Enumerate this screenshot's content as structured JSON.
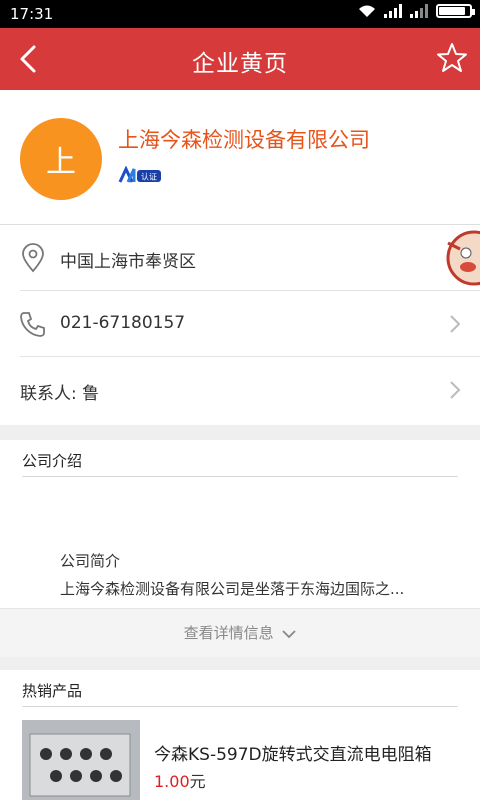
{
  "status_bar": {
    "time": "17:31"
  },
  "nav": {
    "title": "企业黄页"
  },
  "company": {
    "avatar_char": "上",
    "name": "上海今森检测设备有限公司",
    "cert_label": "认证"
  },
  "contact": {
    "address": "中国上海市奉贤区",
    "phone": "021-67180157",
    "contact_person": "联系人: 鲁"
  },
  "intro": {
    "section_title": "公司介绍",
    "subtitle": "公司简介",
    "description": "上海今森检测设备有限公司是坐落于东海边国际之..."
  },
  "more": {
    "label": "查看详情信息"
  },
  "hot_products": {
    "section_title": "热销产品",
    "items": [
      {
        "name": "今森KS-597D旋转式交直流电电阻箱",
        "price": "1.00",
        "unit": "元"
      }
    ]
  },
  "colors": {
    "accent": "#d73a3a",
    "company_name": "#e8531a",
    "avatar": "#f7931e",
    "price": "#e02020"
  }
}
